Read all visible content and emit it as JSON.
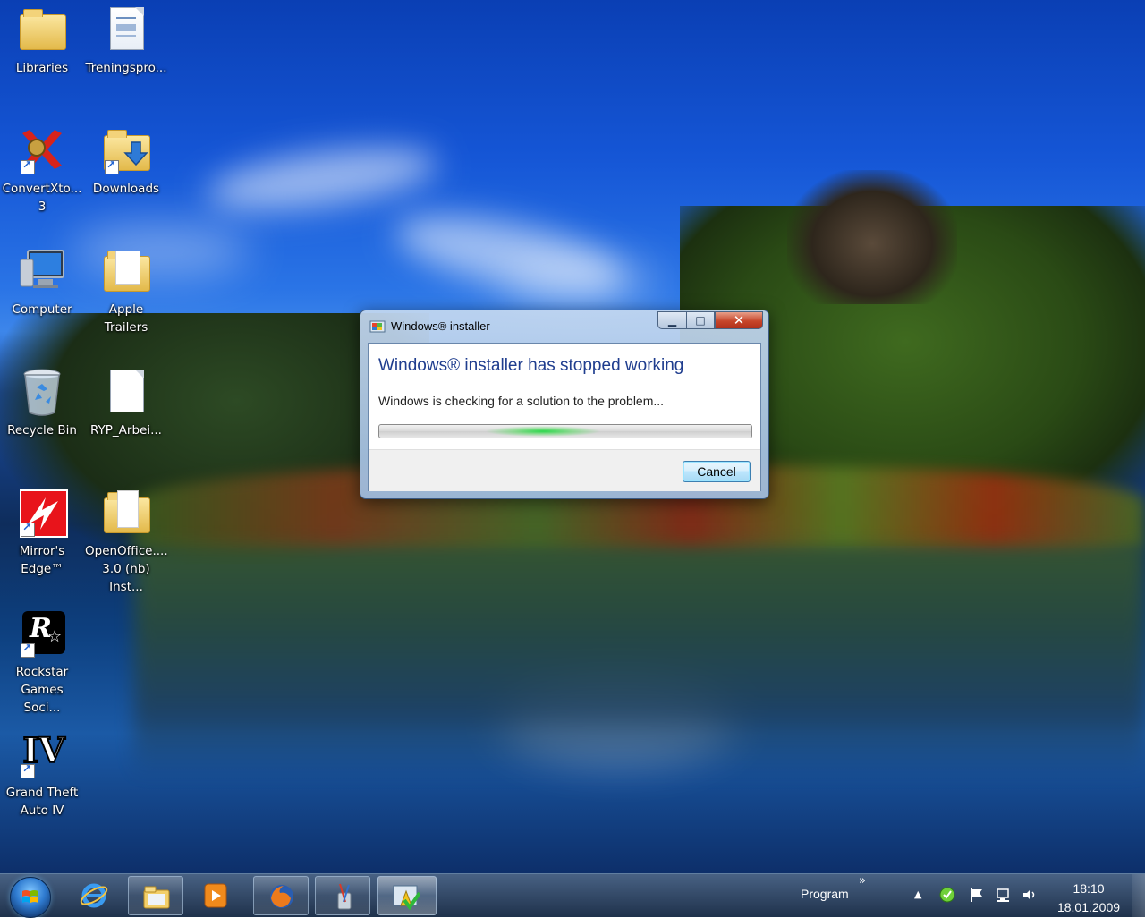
{
  "desktop_icons": [
    {
      "label": "Libraries",
      "icon": "libraries-icon"
    },
    {
      "label": "Treningspro...",
      "icon": "document-icon"
    },
    {
      "label": "ConvertXto...\n3",
      "icon": "convertx-icon"
    },
    {
      "label": "Downloads",
      "icon": "downloads-folder-icon"
    },
    {
      "label": "Computer",
      "icon": "computer-icon"
    },
    {
      "label": "Apple\nTrailers",
      "icon": "folder-icon"
    },
    {
      "label": "Recycle Bin",
      "icon": "recycle-bin-icon"
    },
    {
      "label": "RYP_Arbei...",
      "icon": "blank-document-icon"
    },
    {
      "label": "Mirror's\nEdge™",
      "icon": "mirrors-edge-icon"
    },
    {
      "label": "OpenOffice....\n3.0 (nb) Inst...",
      "icon": "folder-icon"
    },
    {
      "label": "Rockstar\nGames Soci...",
      "icon": "rockstar-icon"
    },
    {
      "label": "Grand Theft\nAuto IV",
      "icon": "gta-iv-icon"
    }
  ],
  "dialog": {
    "title": "Windows® installer",
    "headline": "Windows® installer has stopped working",
    "message": "Windows is checking for a solution to the problem...",
    "cancel_label": "Cancel",
    "minimize_glyph": "▁",
    "maximize_glyph": "□",
    "close_glyph": "✕"
  },
  "taskbar": {
    "pinned": [
      {
        "name": "internet-explorer-icon"
      },
      {
        "name": "windows-explorer-icon"
      },
      {
        "name": "media-player-icon"
      },
      {
        "name": "firefox-icon"
      },
      {
        "name": "paint-tools-icon"
      },
      {
        "name": "windows-installer-icon",
        "active": true
      }
    ],
    "toolbar_label": "Program",
    "toolbar_chevron": "»",
    "tray_arrow": "▲",
    "tray_icons": [
      "security-shield-icon",
      "action-center-flag-icon",
      "network-icon",
      "volume-icon"
    ],
    "time": "18:10",
    "date": "18.01.2009"
  },
  "colors": {
    "headline": "#1f3d8e",
    "close_button": "#c7452a",
    "progress_glow": "#2ad84a"
  }
}
